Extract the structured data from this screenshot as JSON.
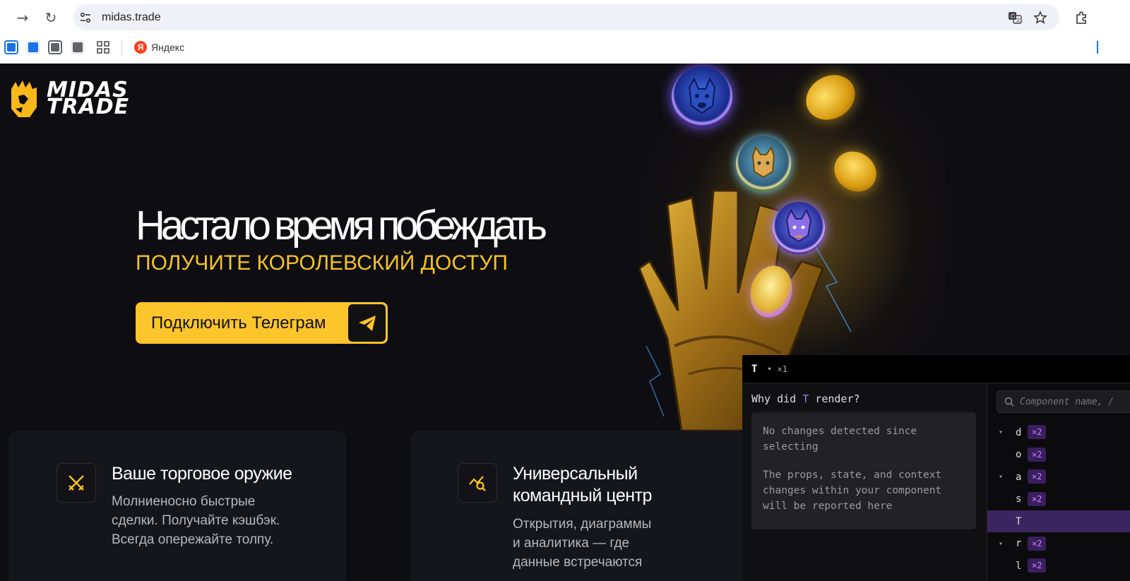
{
  "browser": {
    "url": "midas.trade",
    "bookmarks": [
      {
        "label": "Яндекс",
        "icon": "yandex-icon"
      }
    ],
    "bookmark_icon_colors": [
      "#1a73e8",
      "#1a73e8",
      "#5f6368",
      "#5f6368"
    ]
  },
  "site": {
    "logo_text": "MIDAS TRADE",
    "headline": "Настало время побеждать",
    "subheadline": "ПОЛУЧИТЕ КОРОЛЕВСКИЙ ДОСТУП",
    "cta_label": "Подключить Телеграм",
    "accent_color": "#fcc52c",
    "cards": [
      {
        "title": "Ваше торговое оружие",
        "text_lines": [
          "Молниеносно быстрые",
          "сделки. Получайте кэшбэк.",
          "Всегда опережайте толпу."
        ],
        "icon": "crossed-swords-icon"
      },
      {
        "title_lines": [
          "Универсальный",
          "командный центр"
        ],
        "text_lines": [
          "Открытия, диаграммы",
          "и аналитика — где",
          "данные встречаются"
        ],
        "icon": "chart-search-icon"
      }
    ]
  },
  "devtools": {
    "component": "T",
    "render_count": "• ×1",
    "why_prefix": "Why did ",
    "why_component": "T",
    "why_suffix": " render?",
    "message_1": "No changes detected since selecting",
    "message_2": "The props, state, and context changes within your component will be reported here",
    "search_placeholder": "Component name, /",
    "tree": [
      {
        "name": "d",
        "badge": "×2",
        "expandable": true,
        "selected": false
      },
      {
        "name": "o",
        "badge": "×2",
        "expandable": false,
        "selected": false
      },
      {
        "name": "a",
        "badge": "×2",
        "expandable": true,
        "selected": false
      },
      {
        "name": "s",
        "badge": "×2",
        "expandable": false,
        "selected": false
      },
      {
        "name": "T",
        "badge": "",
        "expandable": false,
        "selected": true
      },
      {
        "name": "r",
        "badge": "×2",
        "expandable": true,
        "selected": false
      },
      {
        "name": "l",
        "badge": "×2",
        "expandable": false,
        "selected": false
      }
    ]
  }
}
